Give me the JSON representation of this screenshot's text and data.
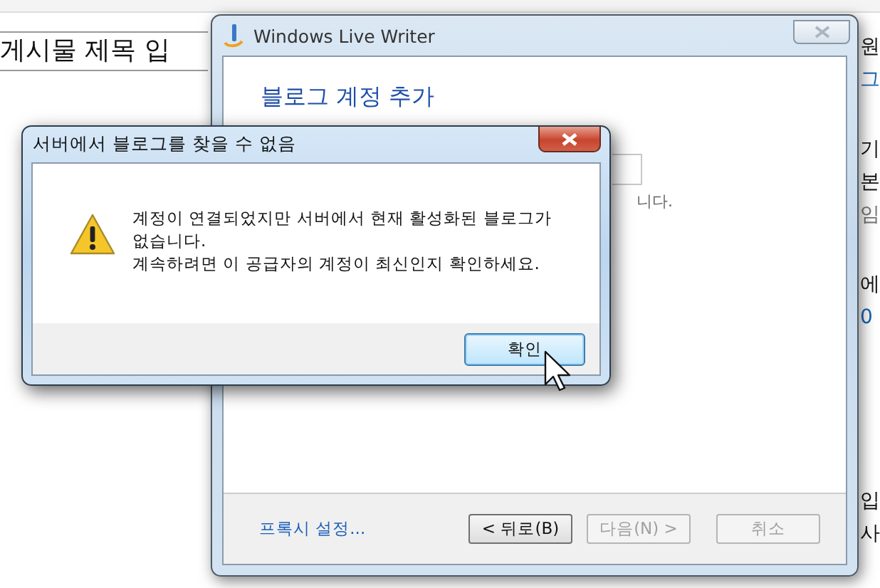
{
  "background_page": {
    "title_field": {
      "value": "게시물 제목 입"
    },
    "sidebar_groups": [
      [
        {
          "text": "원",
          "kind": "text"
        },
        {
          "text": "그",
          "kind": "link"
        }
      ],
      [
        {
          "text": "기",
          "kind": "text"
        },
        {
          "text": "본",
          "kind": "text"
        },
        {
          "text": "임",
          "kind": "muted"
        }
      ],
      [
        {
          "text": "에",
          "kind": "text"
        },
        {
          "text": "0",
          "kind": "link"
        }
      ],
      [
        {
          "text": "입",
          "kind": "text"
        },
        {
          "text": "사",
          "kind": "text"
        }
      ]
    ]
  },
  "main_window": {
    "title": "Windows Live Writer",
    "heading": "블로그 계정 추가",
    "partial_text": "니다.",
    "proxy_link": "프록시 설정...",
    "buttons": [
      {
        "label": "< 뒤로(B)",
        "disabled": false
      },
      {
        "label": "다음(N) >",
        "disabled": true
      },
      {
        "label": "취소",
        "disabled": true
      }
    ]
  },
  "dialog": {
    "title": "서버에서 블로그를 찾을 수 없음",
    "message": "계정이 연결되었지만 서버에서 현재 활성화된 블로그가\n없습니다.\n계속하려면 이 공급자의 계정이 최신인지 확인하세요.",
    "ok_button": {
      "label": "확인",
      "focused": true
    }
  }
}
